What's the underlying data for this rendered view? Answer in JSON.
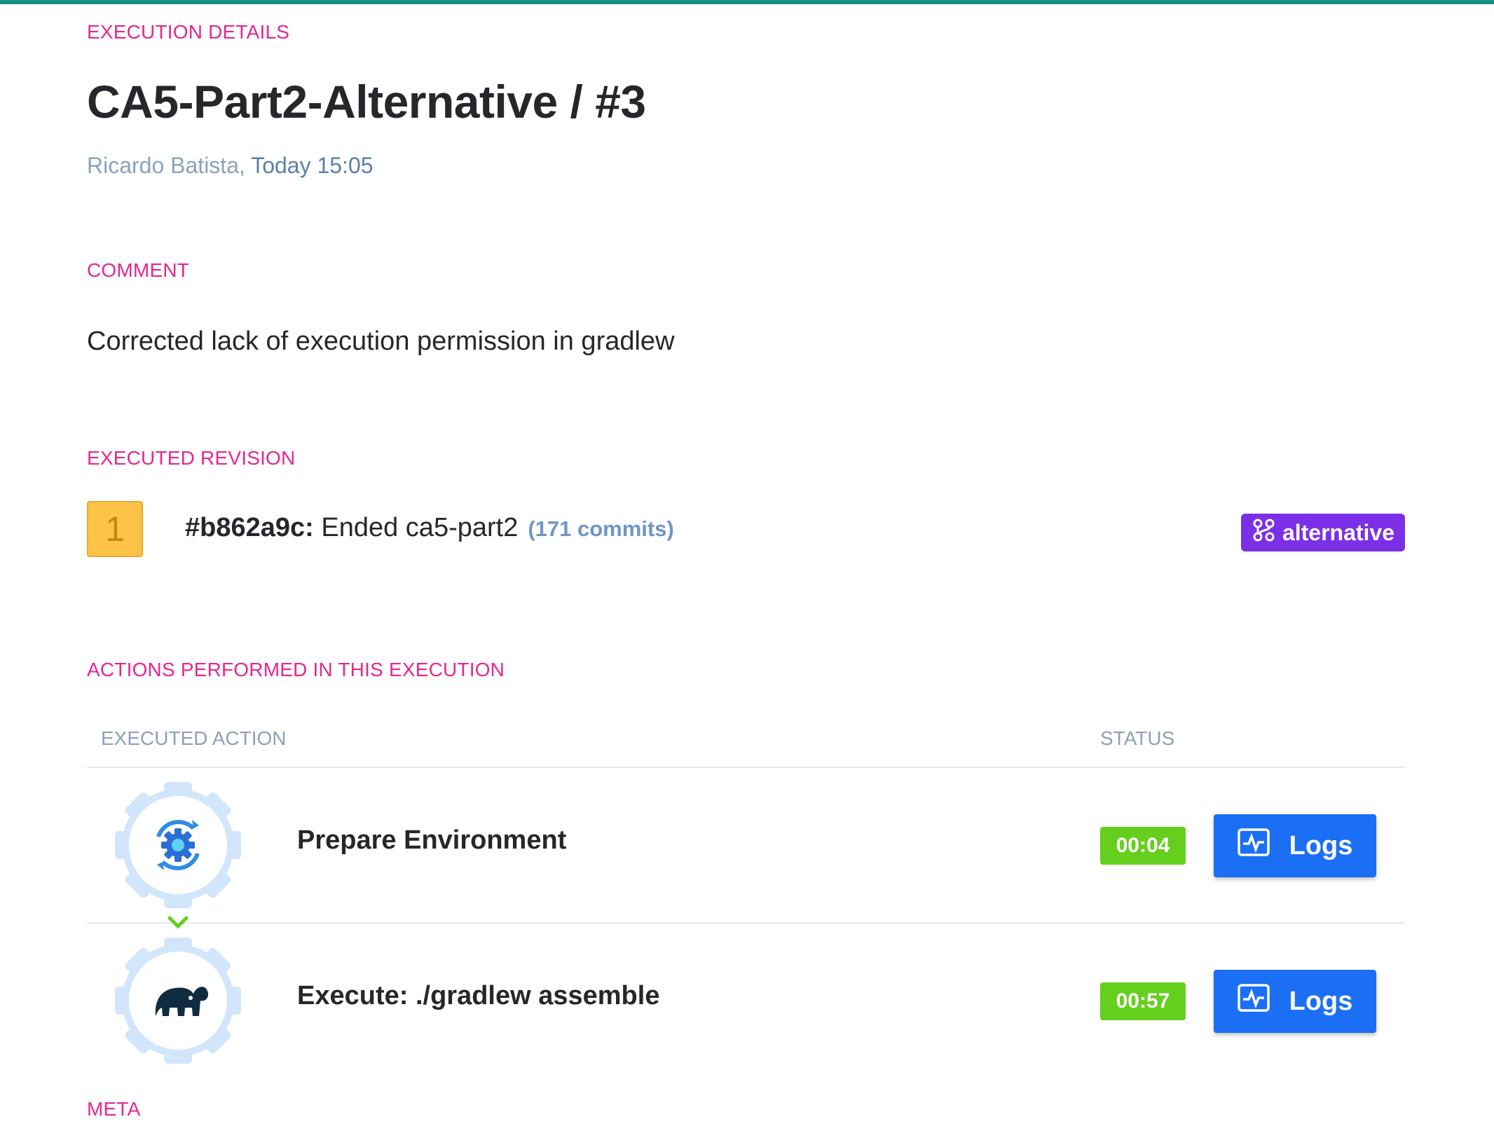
{
  "sections": {
    "execution_details": "EXECUTION DETAILS",
    "comment": "COMMENT",
    "executed_revision": "EXECUTED REVISION",
    "actions": "ACTIONS PERFORMED IN THIS EXECUTION",
    "meta": "META"
  },
  "header": {
    "title": "CA5-Part2-Alternative / #3",
    "author": "Ricardo Batista,",
    "time": " Today 15:05"
  },
  "comment": {
    "text": "Corrected lack of execution permission in gradlew"
  },
  "revision": {
    "number": "1",
    "hash": "#b862a9c:",
    "message": " Ended ca5-part2",
    "commits": "(171 commits)",
    "branch": "alternative"
  },
  "actions_table": {
    "headers": {
      "action": "EXECUTED ACTION",
      "status": "STATUS"
    },
    "rows": [
      {
        "name": "Prepare Environment",
        "duration": "00:04",
        "logs_label": "Logs",
        "icon": "gear-refresh-icon"
      },
      {
        "name": "Execute: ./gradlew assemble",
        "duration": "00:57",
        "logs_label": "Logs",
        "icon": "gradle-elephant-icon"
      }
    ]
  },
  "colors": {
    "accent_top_bar": "#148f83",
    "section_label": "#e6278f",
    "branch_pill": "#7b2fe6",
    "duration_badge": "#64cf1d",
    "logs_button": "#1a6ff5",
    "revision_badge": "#fcc347"
  }
}
